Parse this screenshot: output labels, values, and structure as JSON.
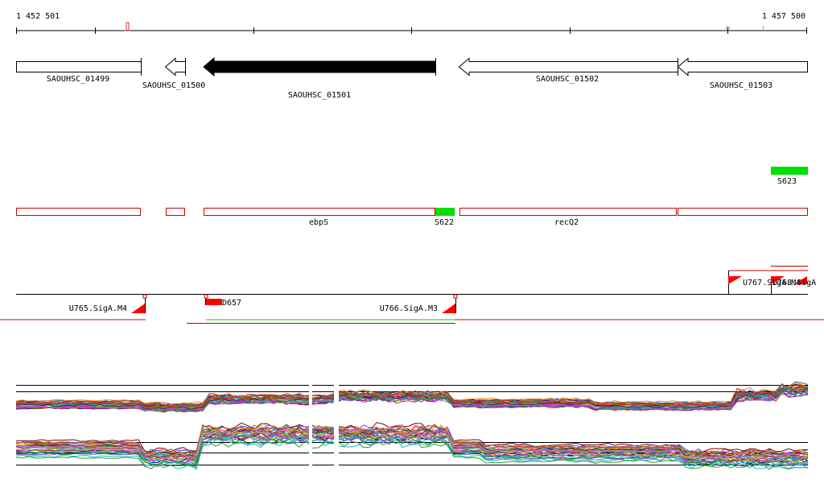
{
  "ruler": {
    "start_label": "1 452 501",
    "end_label": "1 457 500"
  },
  "genes": [
    {
      "id": "gene-1499",
      "label": "SAOUHSC_01499",
      "strand": "+",
      "highlighted": false
    },
    {
      "id": "gene-1500",
      "label": "SAOUHSC_01500",
      "strand": "-",
      "highlighted": false
    },
    {
      "id": "gene-1501",
      "label": "SAOUHSC_01501",
      "strand": "-",
      "highlighted": true
    },
    {
      "id": "gene-1502",
      "label": "SAOUHSC_01502",
      "strand": "-",
      "highlighted": false
    },
    {
      "id": "gene-1503",
      "label": "SAOUHSC_01503",
      "strand": "-",
      "highlighted": false
    }
  ],
  "segments": {
    "s623": "S623",
    "s622": "S622",
    "ebps": "ebpS",
    "recq2": "recQ2"
  },
  "upshifts": {
    "u765": "U765.SigA.M4",
    "u766": "U766.SigA.M3",
    "u767": "U767.SigA.M4",
    "u768": "U768.SigA",
    "d657": "D657"
  },
  "colors": {
    "feature_outline": "#cc0000",
    "segment_fill": "#00e000",
    "gene_fill": "#000000",
    "baseline": "#000000",
    "promoter": "#ff0000",
    "expression_palette": [
      "#1f77b4",
      "#ff7f0e",
      "#2ca02c",
      "#d62728",
      "#9467bd",
      "#8c564b",
      "#e377c2",
      "#7f7f7f",
      "#bcbd22",
      "#17becf",
      "#000080",
      "#800000",
      "#008000",
      "#800080",
      "#808000",
      "#ff00ff",
      "#00aaaa",
      "#aa5500",
      "#5555ff",
      "#333333"
    ]
  },
  "icons": {
    "promoter_flag": "red-flag-icon"
  }
}
